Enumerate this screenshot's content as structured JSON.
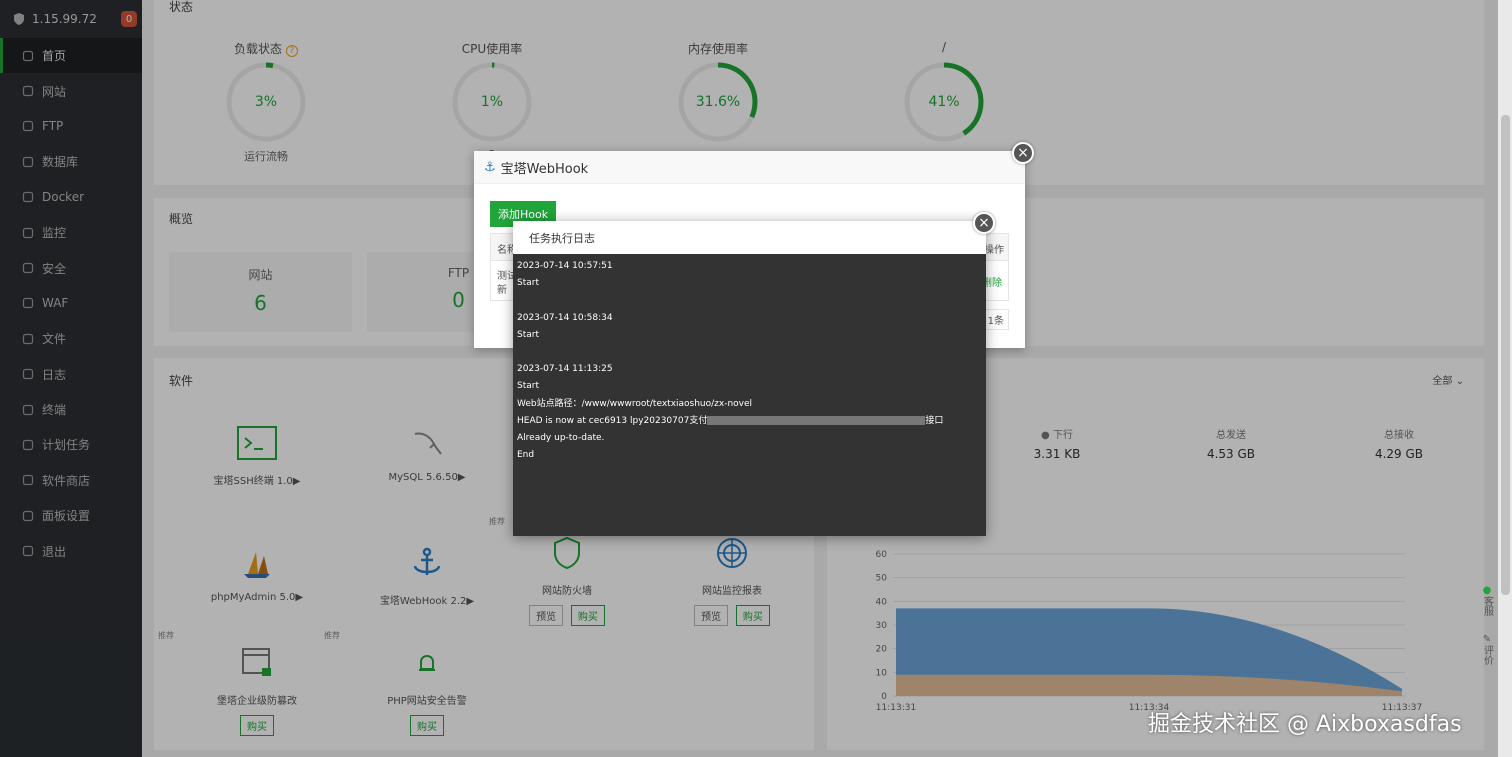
{
  "server": {
    "ip": "1.15.99.72",
    "badge": "0"
  },
  "sidebar": {
    "items": [
      {
        "label": "首页",
        "icon": "home-icon"
      },
      {
        "label": "网站",
        "icon": "globe-icon"
      },
      {
        "label": "FTP",
        "icon": "ftp-icon"
      },
      {
        "label": "数据库",
        "icon": "database-icon"
      },
      {
        "label": "Docker",
        "icon": "docker-icon"
      },
      {
        "label": "监控",
        "icon": "monitor-icon"
      },
      {
        "label": "安全",
        "icon": "shield-icon"
      },
      {
        "label": "WAF",
        "icon": "waf-icon"
      },
      {
        "label": "文件",
        "icon": "folder-icon"
      },
      {
        "label": "日志",
        "icon": "log-icon"
      },
      {
        "label": "终端",
        "icon": "terminal-icon"
      },
      {
        "label": "计划任务",
        "icon": "cron-icon"
      },
      {
        "label": "软件商店",
        "icon": "store-icon"
      },
      {
        "label": "面板设置",
        "icon": "settings-icon"
      },
      {
        "label": "退出",
        "icon": "logout-icon"
      }
    ]
  },
  "status": {
    "title": "状态",
    "gauges": [
      {
        "label": "负载状态",
        "value": "3%",
        "percent": 3,
        "sub": "运行流畅"
      },
      {
        "label": "CPU使用率",
        "value": "1%",
        "percent": 1,
        "sub": "2"
      },
      {
        "label": "内存使用率",
        "value": "31.6%",
        "percent": 31.6,
        "sub": ""
      },
      {
        "label": "/",
        "value": "41%",
        "percent": 41,
        "sub": ""
      }
    ]
  },
  "overview": {
    "title": "概览",
    "stats": [
      {
        "label": "网站",
        "value": "6"
      },
      {
        "label": "FTP",
        "value": "0"
      }
    ]
  },
  "software": {
    "title": "软件",
    "items": [
      {
        "name": "宝塔SSH终端 1.0▶"
      },
      {
        "name": "MySQL 5.6.50▶"
      },
      {
        "name": "phpMyAdmin 5.0▶"
      },
      {
        "name": "宝塔WebHook 2.2▶"
      },
      {
        "name": "网站防火墙",
        "btn1": "预览",
        "btn2": "购买"
      },
      {
        "name": "网站监控报表",
        "btn1": "预览",
        "btn2": "购买"
      },
      {
        "name": "堡塔企业级防篡改",
        "buy": "购买"
      },
      {
        "name": "PHP网站安全告警",
        "buy": "购买"
      }
    ],
    "tag_recommend": "推荐"
  },
  "network": {
    "filter": "全部",
    "cols": [
      {
        "label": "● 下行",
        "value": "3.31 KB"
      },
      {
        "label": "总发送",
        "value": "4.53 GB"
      },
      {
        "label": "总接收",
        "value": "4.29 GB"
      }
    ]
  },
  "chart_data": {
    "type": "area",
    "x": [
      "11:13:31",
      "11:13:34",
      "11:13:37"
    ],
    "yticks": [
      0,
      10,
      20,
      30,
      40,
      50,
      60
    ],
    "ylim": [
      0,
      60
    ],
    "series": [
      {
        "values": [
          37,
          37,
          3
        ],
        "color": "#5b9bd5"
      },
      {
        "values": [
          9,
          9,
          2
        ],
        "color": "#f0c090"
      }
    ]
  },
  "webhook_modal": {
    "title": "宝塔WebHook",
    "add_button": "添加Hook",
    "col_name": "名称",
    "col_ops": "操作",
    "row_name_1": "测试",
    "row_name_2": "新",
    "row_delete": "删除",
    "pager": "1条"
  },
  "log_modal": {
    "title": "任务执行日志",
    "lines": [
      "2023-07-14 10:57:51",
      "Start",
      "",
      "2023-07-14 10:58:34",
      "Start",
      "",
      "2023-07-14 11:13:25",
      "Start",
      "Web站点路径：/www/wwwroot/textxiaoshuo/zx-novel",
      "HEAD is now at cec6913 lpy20230707支付",
      "Already up-to-date.",
      "End"
    ],
    "head_line_suffix": "接口"
  },
  "side_tools": {
    "service": "客服",
    "review": "评价"
  },
  "watermark": "掘金技术社区 @ Aixboxasdfas"
}
